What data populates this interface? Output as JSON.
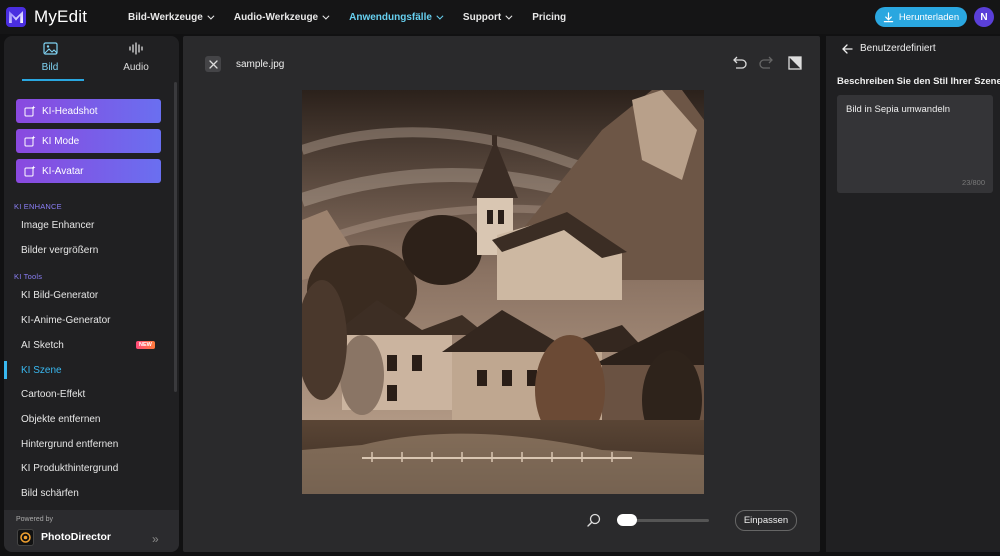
{
  "app": {
    "name": "MyEdit"
  },
  "nav": [
    {
      "label": "Bild-Werkzeuge"
    },
    {
      "label": "Audio-Werkzeuge"
    },
    {
      "label": "Anwendungsfälle"
    },
    {
      "label": "Support"
    },
    {
      "label": "Pricing"
    }
  ],
  "header": {
    "download_label": "Herunterladen",
    "avatar_initial": "N"
  },
  "sidebar": {
    "tabs": [
      {
        "label": "Bild"
      },
      {
        "label": "Audio"
      }
    ],
    "featured": [
      {
        "label": "KI-Headshot"
      },
      {
        "label": "KI Mode"
      },
      {
        "label": "KI-Avatar"
      }
    ],
    "sections": {
      "enhance": "KI ENHANCE",
      "tools": "KI Tools"
    },
    "enhance_items": [
      {
        "label": "Image Enhancer"
      },
      {
        "label": "Bilder vergrößern"
      }
    ],
    "tool_items": [
      {
        "label": "KI Bild-Generator"
      },
      {
        "label": "KI-Anime-Generator"
      },
      {
        "label": "AI Sketch",
        "badge": "NEW"
      },
      {
        "label": "KI Szene"
      },
      {
        "label": "Cartoon-Effekt"
      },
      {
        "label": "Objekte entfernen"
      },
      {
        "label": "Hintergrund entfernen"
      },
      {
        "label": "KI Produkthintergrund"
      },
      {
        "label": "Bild schärfen"
      }
    ],
    "powered_by": {
      "label": "Powered by",
      "name": "PhotoDirector"
    }
  },
  "editor": {
    "filename": "sample.jpg",
    "fit_label": "Einpassen",
    "zoom_fraction": 0.0
  },
  "panel": {
    "back_label": "Benutzerdefiniert",
    "prompt_label": "Beschreiben Sie den Stil Ihrer Szene",
    "prompt_value": "Bild in Sepia umwandeln",
    "char_count": "23/800"
  },
  "colors": {
    "accent": "#2aa7e0",
    "active_nav": "#67d0f0",
    "featured_start": "#8a49df",
    "featured_end": "#6a6ff0"
  }
}
